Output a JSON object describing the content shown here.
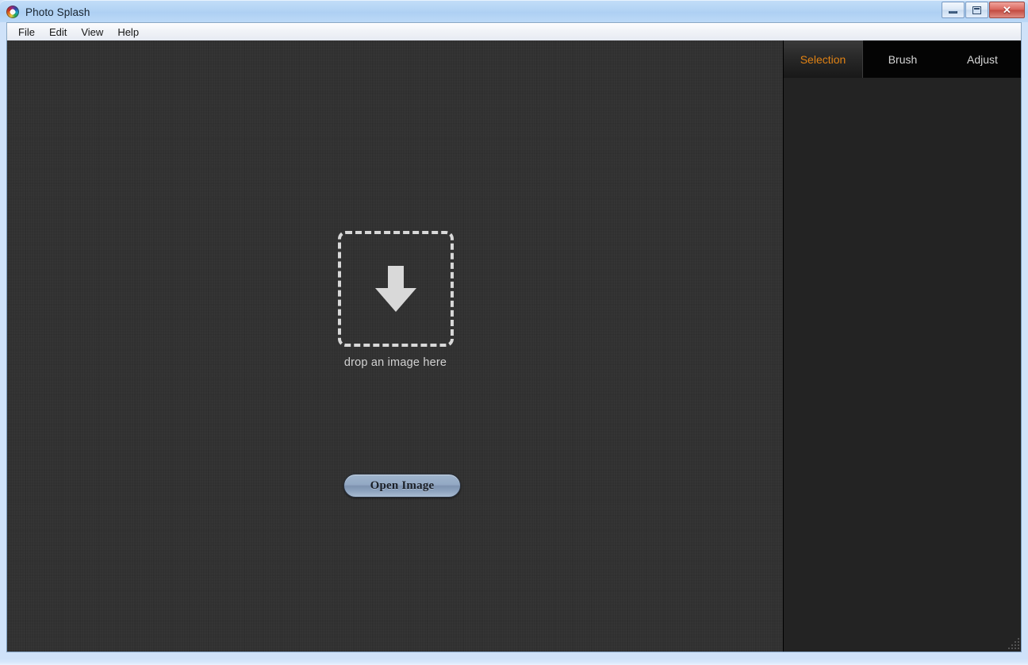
{
  "window": {
    "title": "Photo Splash",
    "icon": "app-ring-icon",
    "controls": {
      "minimize_label": "–",
      "maximize_label": "□",
      "close_label": "✕"
    }
  },
  "menu": {
    "items": [
      {
        "label": "File"
      },
      {
        "label": "Edit"
      },
      {
        "label": "View"
      },
      {
        "label": "Help"
      }
    ]
  },
  "canvas": {
    "dropzone": {
      "icon": "arrow-down-icon",
      "label": "drop an image here"
    },
    "open_image_button": {
      "label": "Open Image"
    },
    "background_color": "#313131"
  },
  "side_panel": {
    "background_color": "#232323",
    "active_tab": "Selection",
    "active_tab_color": "#e08214",
    "tabs": [
      {
        "label": "Selection",
        "active": true
      },
      {
        "label": "Brush",
        "active": false
      },
      {
        "label": "Adjust",
        "active": false
      }
    ]
  },
  "status": {
    "resize_grip": "resize-grip"
  }
}
